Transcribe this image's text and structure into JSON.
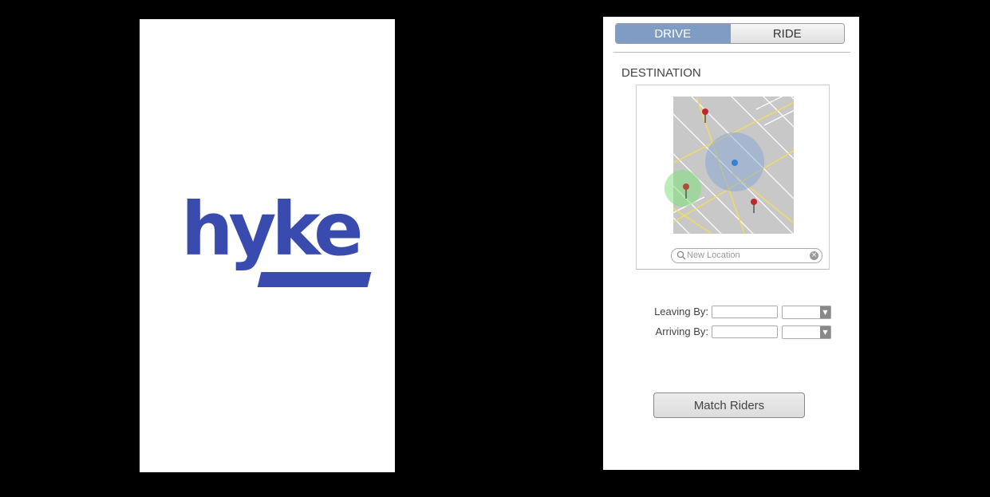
{
  "splash": {
    "logo_text": "hyke",
    "brand_color": "#3a4bb0"
  },
  "app": {
    "tabs": {
      "drive": "DRIVE",
      "ride": "RIDE",
      "active_color": "#7f9dc4"
    },
    "destination_title": "DESTINATION",
    "map": {
      "search_placeholder": "New Location",
      "search_icon": "search-icon",
      "clear_icon": "clear-icon",
      "current_location_color": "#3b7fd0",
      "pin_color": "#c0262b"
    },
    "leaving_label": "Leaving By:",
    "arriving_label": "Arriving By:",
    "match_button": "Match Riders"
  }
}
